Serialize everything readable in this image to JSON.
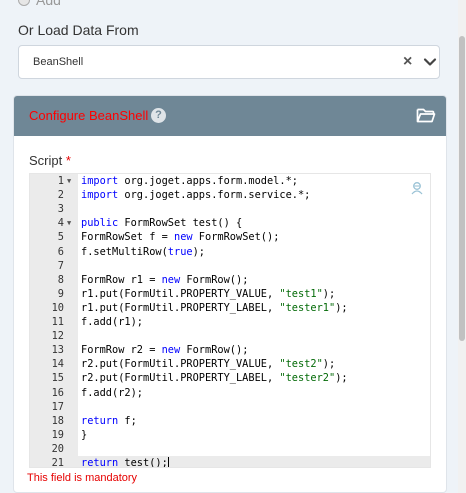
{
  "top_option": {
    "label": "Add"
  },
  "load_section": {
    "label": "Or Load Data From",
    "selected": "BeanShell"
  },
  "config_panel": {
    "title": "Configure BeanShell",
    "script_label": "Script",
    "required_mark": "*",
    "error": "This field is mandatory"
  },
  "code_lines": [
    {
      "n": "1",
      "fold": true,
      "parts": [
        [
          "kw",
          "import"
        ],
        [
          "",
          "org.joget.apps.form.model.*;"
        ]
      ]
    },
    {
      "n": "2",
      "parts": [
        [
          "kw",
          "import"
        ],
        [
          "",
          "org.joget.apps.form.service.*;"
        ]
      ]
    },
    {
      "n": "3",
      "parts": []
    },
    {
      "n": "4",
      "fold": true,
      "parts": [
        [
          "kw",
          "public"
        ],
        [
          "",
          " FormRowSet test() {"
        ]
      ]
    },
    {
      "n": "5",
      "parts": [
        [
          "",
          "FormRowSet f = "
        ],
        [
          "kw",
          "new"
        ],
        [
          "",
          " FormRowSet();"
        ]
      ]
    },
    {
      "n": "6",
      "parts": [
        [
          "",
          "f.setMultiRow("
        ],
        [
          "kw",
          "true"
        ],
        [
          "",
          ");"
        ]
      ]
    },
    {
      "n": "7",
      "parts": []
    },
    {
      "n": "8",
      "parts": [
        [
          "",
          "FormRow r1 = "
        ],
        [
          "kw",
          "new"
        ],
        [
          "",
          " FormRow();"
        ]
      ]
    },
    {
      "n": "9",
      "parts": [
        [
          "",
          "r1.put(FormUtil.PROPERTY_VALUE, "
        ],
        [
          "str",
          "\"test1\""
        ],
        [
          "",
          ");"
        ]
      ]
    },
    {
      "n": "10",
      "parts": [
        [
          "",
          "r1.put(FormUtil.PROPERTY_LABEL, "
        ],
        [
          "str",
          "\"tester1\""
        ],
        [
          "",
          ");"
        ]
      ]
    },
    {
      "n": "11",
      "parts": [
        [
          "",
          "f.add(r1);"
        ]
      ]
    },
    {
      "n": "12",
      "parts": []
    },
    {
      "n": "13",
      "parts": [
        [
          "",
          "FormRow r2 = "
        ],
        [
          "kw",
          "new"
        ],
        [
          "",
          " FormRow();"
        ]
      ]
    },
    {
      "n": "14",
      "parts": [
        [
          "",
          "r2.put(FormUtil.PROPERTY_VALUE, "
        ],
        [
          "str",
          "\"test2\""
        ],
        [
          "",
          ");"
        ]
      ]
    },
    {
      "n": "15",
      "parts": [
        [
          "",
          "r2.put(FormUtil.PROPERTY_LABEL, "
        ],
        [
          "str",
          "\"tester2\""
        ],
        [
          "",
          ");"
        ]
      ]
    },
    {
      "n": "16",
      "parts": [
        [
          "",
          "f.add(r2);"
        ]
      ]
    },
    {
      "n": "17",
      "parts": []
    },
    {
      "n": "18",
      "parts": [
        [
          "kw",
          "return"
        ],
        [
          "",
          " f;"
        ]
      ]
    },
    {
      "n": "19",
      "parts": [
        [
          "",
          "}"
        ]
      ]
    },
    {
      "n": "20",
      "parts": []
    },
    {
      "n": "21",
      "active": true,
      "cursor": true,
      "parts": [
        [
          "kw",
          "return"
        ],
        [
          "",
          " test();"
        ]
      ]
    }
  ],
  "colors": {
    "header_bg": "#6f8796",
    "title_red": "#ff0000",
    "keyword": "#0000ff",
    "string": "#036a07",
    "error": "#e60000"
  }
}
